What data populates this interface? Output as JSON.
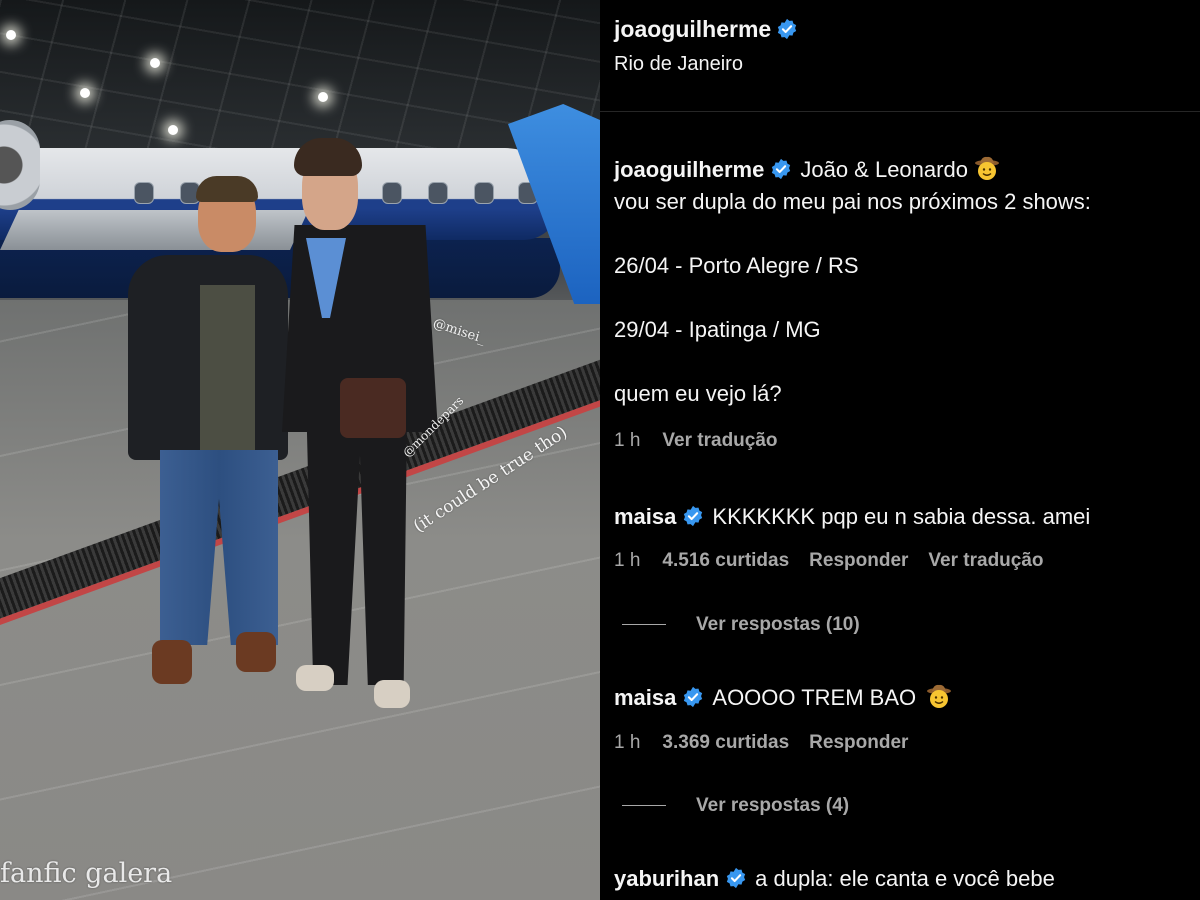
{
  "photo": {
    "overlay_tags": {
      "misei": "@misei_",
      "mondepars": "@mondepars",
      "truth": "(it could be true tho)",
      "watermark": "fanfic galera"
    }
  },
  "post": {
    "author": "joaoguilherme",
    "location": "Rio de Janeiro",
    "caption": {
      "lead": "João & Leonardo",
      "emoji": "cowboy-face-emoji",
      "line2": "vou ser dupla do meu pai nos próximos 2 shows:",
      "show1": "26/04 - Porto Alegre / RS",
      "show2": "29/04 - Ipatinga / MG",
      "closing": "quem eu vejo lá?"
    },
    "time": "1 h",
    "translate": "Ver tradução"
  },
  "comments": [
    {
      "user": "maisa",
      "text": "KKKKKKK pqp eu n sabia dessa. amei",
      "time": "1 h",
      "likes": "4.516 curtidas",
      "reply": "Responder",
      "translate": "Ver tradução",
      "view_replies": "Ver respostas (10)"
    },
    {
      "user": "maisa",
      "text": "AOOOO TREM BAO",
      "emoji": "cowboy-face-emoji",
      "time": "1 h",
      "likes": "3.369 curtidas",
      "reply": "Responder",
      "view_replies": "Ver respostas (4)"
    },
    {
      "user": "yaburihan",
      "text": "a dupla: ele canta e você bebe"
    }
  ],
  "colors": {
    "background": "#000000",
    "text": "#f5f5f5",
    "muted": "#a8a8a8",
    "verified": "#3897f0"
  }
}
